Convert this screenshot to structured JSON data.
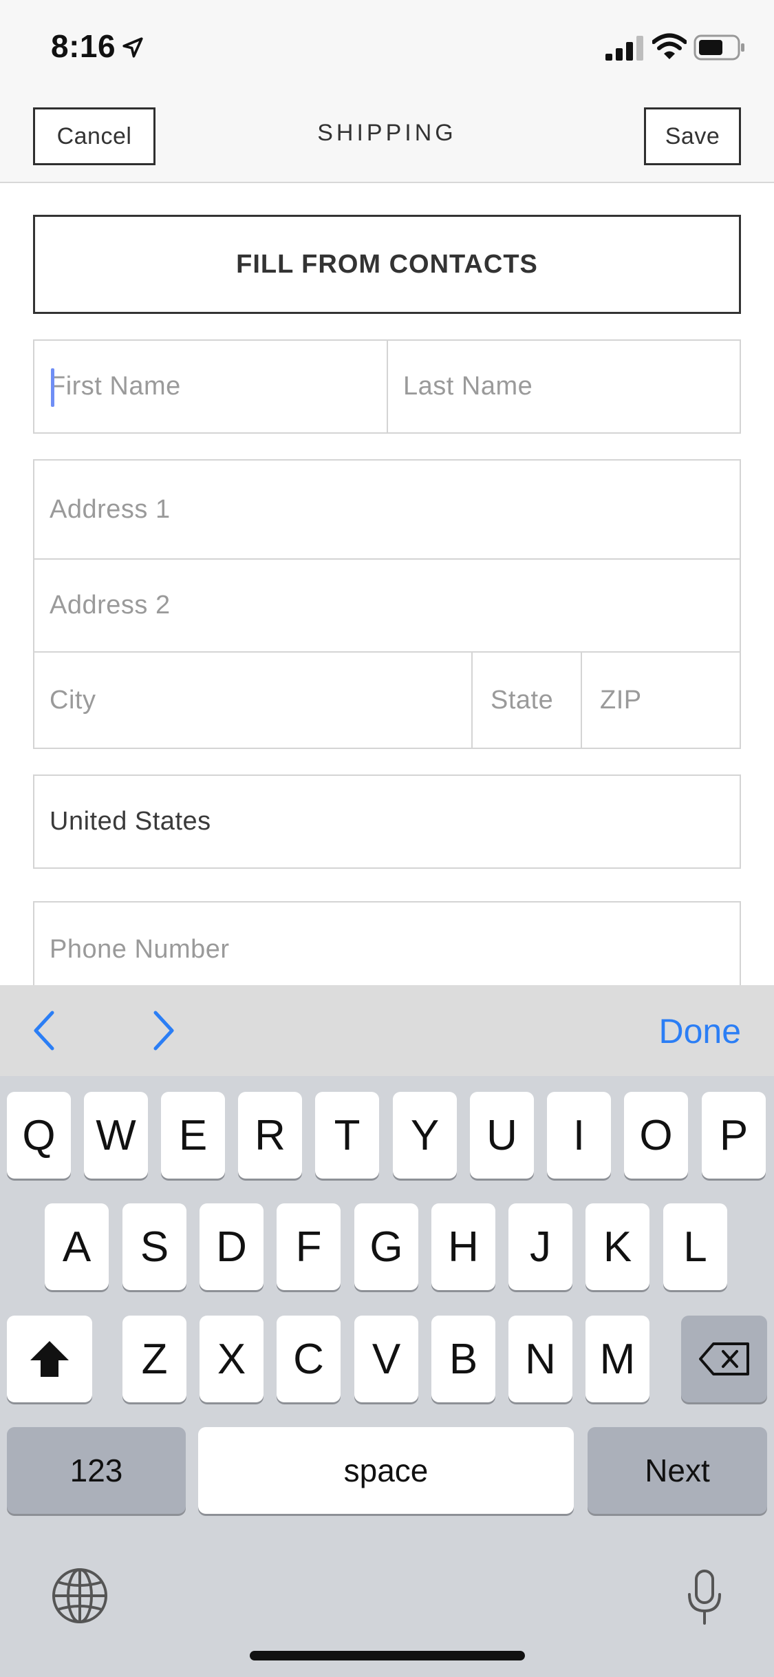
{
  "status_bar": {
    "time": "8:16",
    "icons": [
      "location-arrow-icon",
      "cellular-signal-icon",
      "wifi-icon",
      "battery-icon"
    ]
  },
  "nav": {
    "cancel_label": "Cancel",
    "title": "SHIPPING",
    "save_label": "Save"
  },
  "form": {
    "fill_from_contacts_label": "FILL FROM CONTACTS",
    "first_name_placeholder": "First Name",
    "last_name_placeholder": "Last Name",
    "address1_placeholder": "Address 1",
    "address2_placeholder": "Address 2",
    "city_placeholder": "City",
    "state_placeholder": "State",
    "zip_placeholder": "ZIP",
    "country_value": "United States",
    "phone_placeholder": "Phone Number"
  },
  "keyboard_accessory": {
    "done_label": "Done",
    "icons": [
      "chevron-left-icon",
      "chevron-right-icon"
    ],
    "accent_color": "#2b7ef5"
  },
  "keyboard": {
    "row1": [
      "Q",
      "W",
      "E",
      "R",
      "T",
      "Y",
      "U",
      "I",
      "O",
      "P"
    ],
    "row2": [
      "A",
      "S",
      "D",
      "F",
      "G",
      "H",
      "J",
      "K",
      "L"
    ],
    "row3": [
      "Z",
      "X",
      "C",
      "V",
      "B",
      "N",
      "M"
    ],
    "numbers_label": "123",
    "space_label": "space",
    "next_label": "Next",
    "icons": [
      "shift-icon",
      "backspace-icon",
      "globe-icon",
      "microphone-icon"
    ]
  }
}
